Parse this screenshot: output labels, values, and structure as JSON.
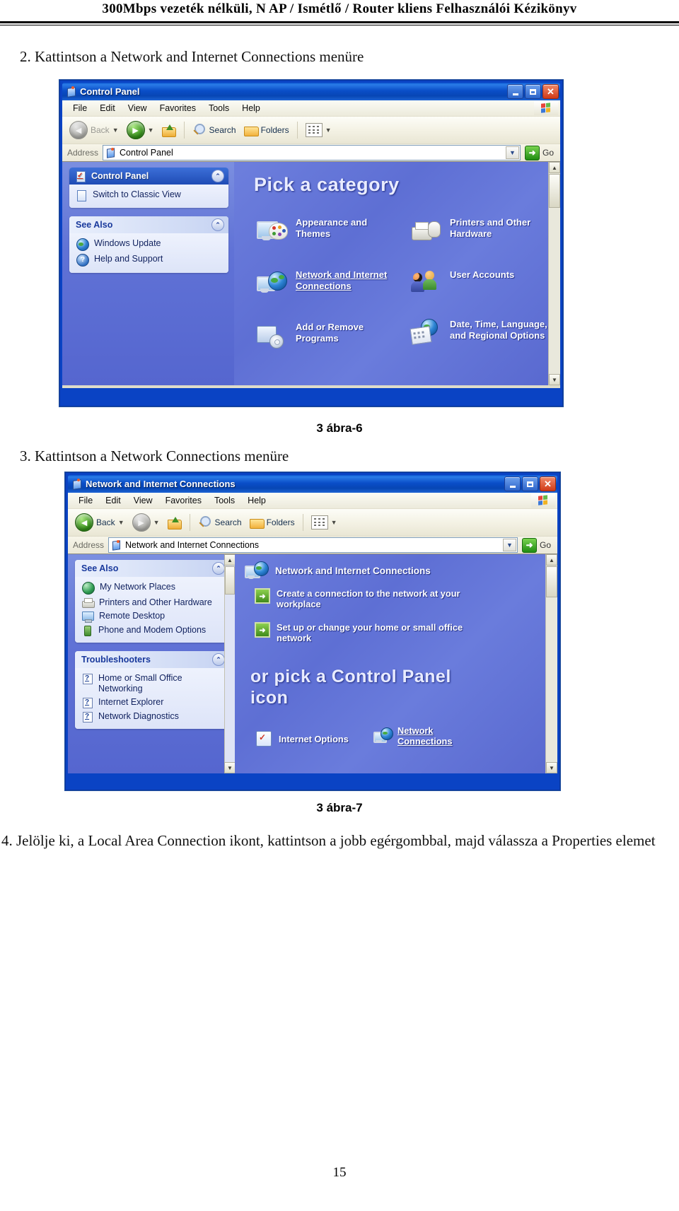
{
  "document": {
    "running_header": "300Mbps vezeték nélküli, N AP / Ismétlő / Router kliens   Felhasználói Kézikönyv",
    "page_number": "15",
    "step2": "2. Kattintson a Network and Internet Connections menüre",
    "step3": "3. Kattintson a Network Connections menüre",
    "step4": "4. Jelölje ki, a Local Area Connection ikont, kattintson a jobb egérgombbal, majd válassza a Properties elemet",
    "figure6_caption": "3 ábra-6",
    "figure7_caption": "3 ábra-7"
  },
  "colors": {
    "titlebar_blue": "#0a4ec8",
    "close_red": "#d03a17",
    "pane_blue": "#6375d8",
    "sidebar_panel": "#d6dff7",
    "selected_header": "#1f4cb5",
    "go_green": "#1f8c12"
  },
  "window1": {
    "title": "Control Panel",
    "icon": "control-panel-icon",
    "buttons": {
      "minimize": "_",
      "maximize": "□",
      "close": "✕"
    },
    "menu": [
      "File",
      "Edit",
      "View",
      "Favorites",
      "Tools",
      "Help"
    ],
    "toolbar": {
      "back": "Back",
      "forward": "",
      "up": "",
      "search": "Search",
      "folders": "Folders",
      "views": ""
    },
    "address": {
      "label": "Address",
      "value": "Control Panel",
      "go": "Go"
    },
    "sidebar": {
      "panels": [
        {
          "title": "Control Panel",
          "selected": true,
          "items": [
            {
              "label": "Switch to Classic View",
              "icon": "control-panel-icon"
            }
          ]
        },
        {
          "title": "See Also",
          "selected": false,
          "items": [
            {
              "label": "Windows Update",
              "icon": "windows-update-icon"
            },
            {
              "label": "Help and Support",
              "icon": "help-icon"
            }
          ]
        }
      ]
    },
    "main": {
      "heading": "Pick a category",
      "categories": [
        {
          "label": "Appearance and Themes",
          "icon": "appearance-themes-icon",
          "link": false
        },
        {
          "label": "Printers and Other Hardware",
          "icon": "printers-hardware-icon",
          "link": false
        },
        {
          "label": "Network and Internet Connections",
          "icon": "network-internet-icon",
          "link": true
        },
        {
          "label": "User Accounts",
          "icon": "user-accounts-icon",
          "link": false
        },
        {
          "label": "Add or Remove Programs",
          "icon": "add-remove-programs-icon",
          "link": false
        },
        {
          "label": "Date, Time, Language, and Regional Options",
          "icon": "date-time-regional-icon",
          "link": false
        }
      ]
    }
  },
  "window2": {
    "title": "Network and Internet Connections",
    "icon": "control-panel-icon",
    "buttons": {
      "minimize": "_",
      "maximize": "□",
      "close": "✕"
    },
    "menu": [
      "File",
      "Edit",
      "View",
      "Favorites",
      "Tools",
      "Help"
    ],
    "toolbar": {
      "back": "Back",
      "forward": "",
      "up": "",
      "search": "Search",
      "folders": "Folders",
      "views": ""
    },
    "address": {
      "label": "Address",
      "value": "Network and Internet Connections",
      "go": "Go"
    },
    "sidebar": {
      "panels": [
        {
          "title": "See Also",
          "selected": false,
          "items": [
            {
              "label": "My Network Places",
              "icon": "my-network-places-icon"
            },
            {
              "label": "Printers and Other Hardware",
              "icon": "printers-hardware-icon"
            },
            {
              "label": "Remote Desktop",
              "icon": "remote-desktop-icon"
            },
            {
              "label": "Phone and Modem Options",
              "icon": "phone-modem-icon"
            }
          ]
        },
        {
          "title": "Troubleshooters",
          "selected": false,
          "items": [
            {
              "label": "Home or Small Office Networking",
              "icon": "troubleshooter-icon"
            },
            {
              "label": "Internet Explorer",
              "icon": "troubleshooter-icon"
            },
            {
              "label": "Network Diagnostics",
              "icon": "troubleshooter-icon"
            }
          ]
        }
      ]
    },
    "main": {
      "section_title": "Network and Internet Connections",
      "section_icon": "network-internet-icon",
      "tasks": [
        {
          "label": "Create a connection to the network at your workplace",
          "icon": "arrow-task-icon"
        },
        {
          "label": "Set up or change your home or small office network",
          "icon": "arrow-task-icon"
        }
      ],
      "heading": "or pick a Control Panel icon",
      "icons": [
        {
          "label": "Internet Options",
          "icon": "internet-options-icon",
          "link": false
        },
        {
          "label": "Network Connections",
          "icon": "network-connections-icon",
          "link": true
        }
      ]
    }
  }
}
